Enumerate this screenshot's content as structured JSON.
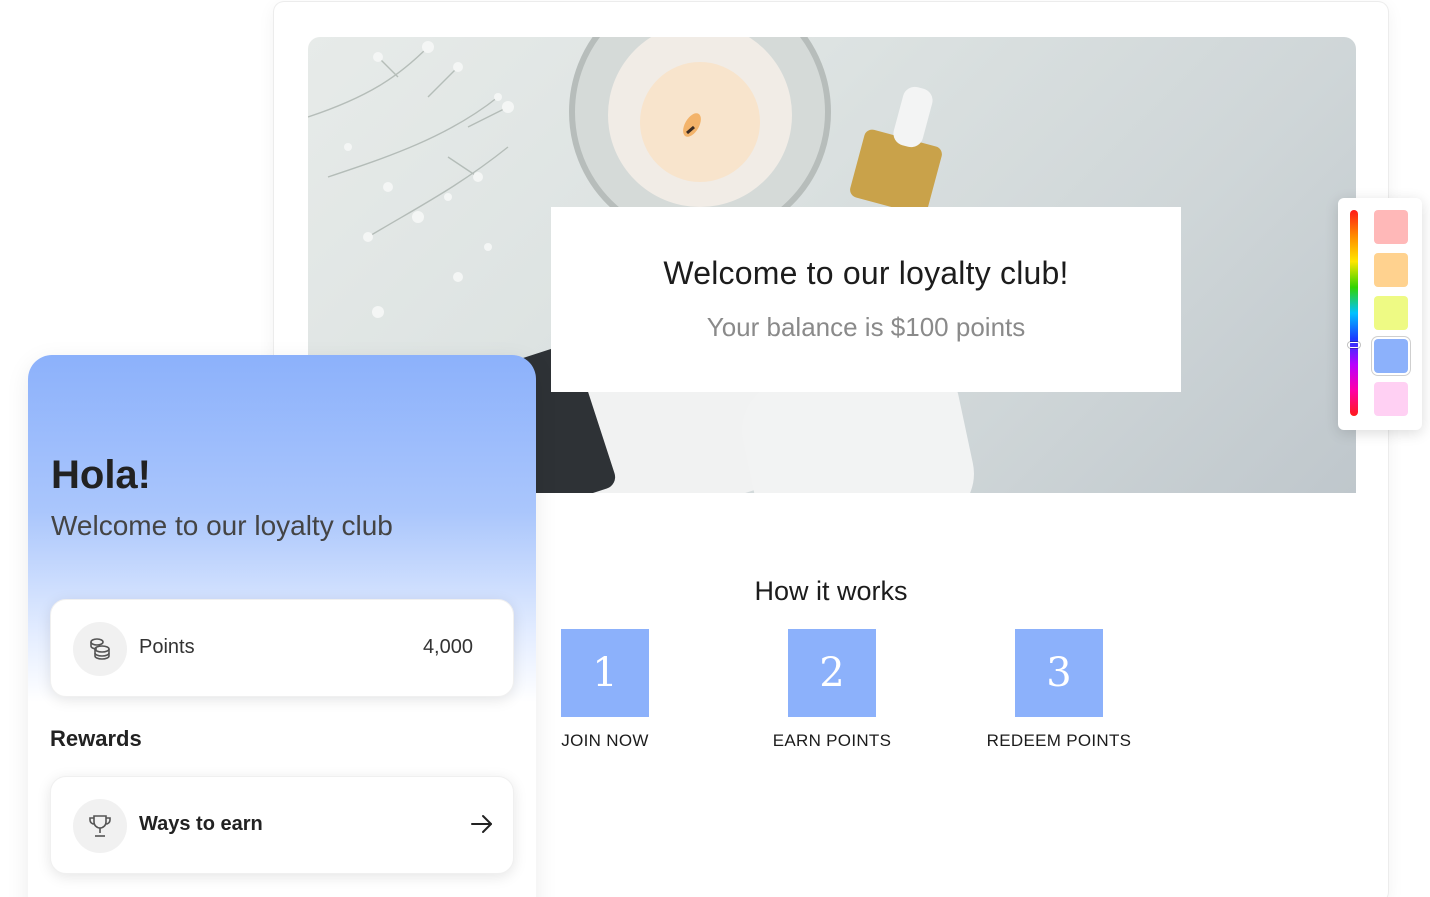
{
  "hero": {
    "title": "Welcome to our loyalty club!",
    "subtitle": "Your balance is $100 points"
  },
  "how_it_works": {
    "title": "How it works",
    "steps": [
      {
        "number": "1",
        "label": "JOIN NOW"
      },
      {
        "number": "2",
        "label": "EARN POINTS"
      },
      {
        "number": "3",
        "label": "REDEEM POINTS"
      }
    ],
    "step_color": "#8cb1fb"
  },
  "color_picker": {
    "swatches": [
      "#ffb8b8",
      "#ffd28f",
      "#eefa84",
      "#8cb1fb",
      "#ffd0f3"
    ],
    "selected_index": 3
  },
  "widget": {
    "greeting": "Hola!",
    "greeting_sub": "Welcome to our loyalty club",
    "points": {
      "label": "Points",
      "value": "4,000",
      "icon": "coins-icon"
    },
    "rewards_title": "Rewards",
    "ways_to_earn": {
      "label": "Ways to earn",
      "icon": "trophy-icon",
      "action_icon": "arrow-right-icon"
    },
    "gradient_color": "#8cb1fb"
  }
}
